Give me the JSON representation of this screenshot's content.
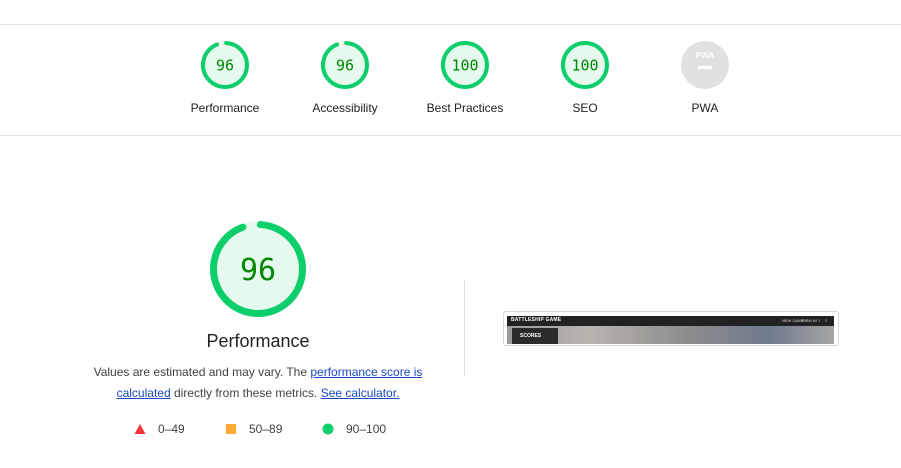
{
  "scores": [
    {
      "label": "Performance",
      "value": "96",
      "score": 96,
      "status": "pass"
    },
    {
      "label": "Accessibility",
      "value": "96",
      "score": 96,
      "status": "pass"
    },
    {
      "label": "Best Practices",
      "value": "100",
      "score": 100,
      "status": "pass"
    },
    {
      "label": "SEO",
      "value": "100",
      "score": 100,
      "status": "pass"
    },
    {
      "label": "PWA",
      "value": "PWA",
      "score": null,
      "status": "na"
    }
  ],
  "main": {
    "score": "96",
    "score_value": 96,
    "title": "Performance",
    "desc_text_1": "Values are estimated and may vary. The ",
    "desc_link_1": "performance score is calculated",
    "desc_text_2": " directly from these metrics. ",
    "desc_link_2": "See calculator."
  },
  "legend": [
    {
      "range": "0–49",
      "shape": "triangle",
      "color": "#ff3333"
    },
    {
      "range": "50–89",
      "shape": "square",
      "color": "#ffaa33"
    },
    {
      "range": "90–100",
      "shape": "circle",
      "color": "#0cce6b"
    }
  ],
  "screenshot": {
    "brand": "BATTLESHIP GAME",
    "nav_1": "NEW GAME ?",
    "nav_2": "SIGN IN ?",
    "nav_3": "≡",
    "panel": "SCORES"
  },
  "colors": {
    "pass_ring": "#0cce6b",
    "pass_fill": "#e6f9ee",
    "pass_text": "#008800",
    "na_fill": "#e1e1e1",
    "na_text": "#ffffff",
    "link": "#1a47c7"
  }
}
